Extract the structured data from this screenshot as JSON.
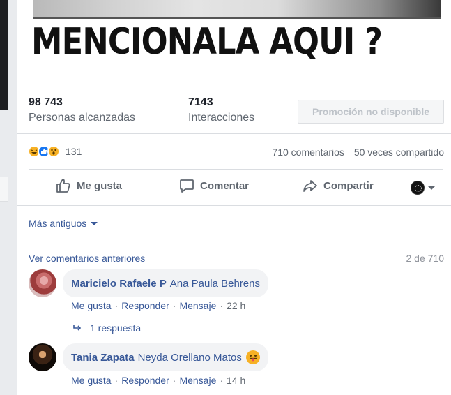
{
  "post": {
    "caption": "MENCIONALA AQUI ?"
  },
  "stats": {
    "reach_value": "98 743",
    "reach_label": "Personas alcanzadas",
    "engagement_value": "7143",
    "engagement_label": "Interacciones",
    "promote_label": "Promoción no disponible"
  },
  "reactions": {
    "count": "131",
    "types": [
      "haha",
      "like",
      "wow"
    ],
    "comments_count": "710 comentarios",
    "shares_count": "50 veces compartido"
  },
  "actions": {
    "like": "Me gusta",
    "comment": "Comentar",
    "share": "Compartir"
  },
  "comments_section": {
    "sort_label": "Más antiguos",
    "view_previous": "Ver comentarios anteriores",
    "page_count": "2 de 710",
    "comments": [
      {
        "author": "Maricielo Rafaele P",
        "tagged": "Ana Paula Behrens",
        "like": "Me gusta",
        "reply": "Responder",
        "message": "Mensaje",
        "time": "22 h",
        "replies": "1 respuesta"
      },
      {
        "author": "Tania Zapata",
        "tagged": "Neyda Orellano Matos",
        "emoji": "tongue-emoji",
        "like": "Me gusta",
        "reply": "Responder",
        "message": "Mensaje",
        "time": "14 h"
      }
    ]
  },
  "colors": {
    "link": "#385898",
    "like_blue": "#1877f2",
    "emoji_yellow": "#f7b125",
    "muted_text": "#606770"
  }
}
